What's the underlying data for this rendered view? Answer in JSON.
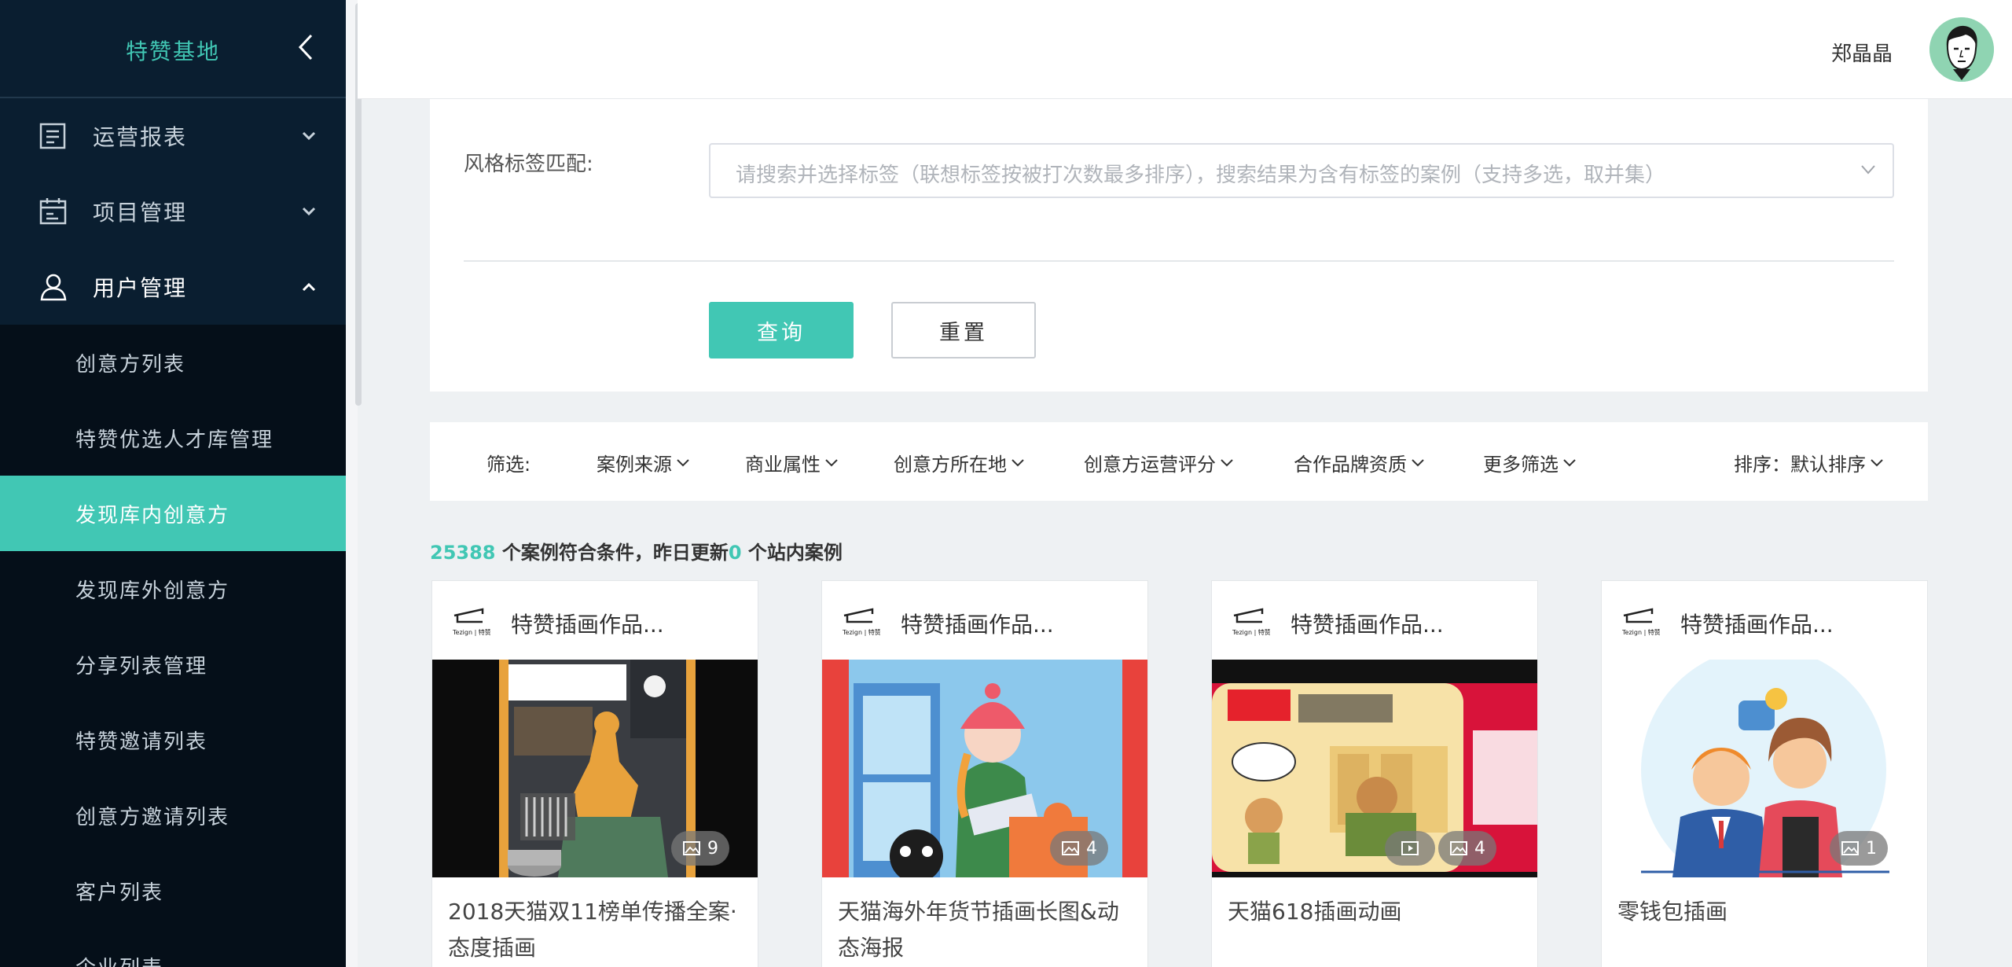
{
  "sidebar": {
    "brand": "特赞基地",
    "menus": [
      {
        "label": "运营报表",
        "icon": "report-icon"
      },
      {
        "label": "项目管理",
        "icon": "calendar-icon"
      },
      {
        "label": "用户管理",
        "icon": "user-icon"
      }
    ],
    "sub_items": [
      {
        "label": "创意方列表"
      },
      {
        "label": "特赞优选人才库管理"
      },
      {
        "label": "发现库内创意方"
      },
      {
        "label": "发现库外创意方"
      },
      {
        "label": "分享列表管理"
      },
      {
        "label": "特赞邀请列表"
      },
      {
        "label": "创意方邀请列表"
      },
      {
        "label": "客户列表"
      },
      {
        "label": "企业列表"
      }
    ],
    "active_item": "发现库内创意方"
  },
  "header": {
    "user_name": "郑晶晶"
  },
  "search": {
    "tag_label": "风格标签匹配:",
    "tag_placeholder": "请搜索并选择标签（联想标签按被打次数最多排序），搜索结果为含有标签的案例（支持多选，取并集）",
    "query_button": "查询",
    "reset_button": "重置"
  },
  "filters": {
    "label": "筛选:",
    "items": [
      "案例来源",
      "商业属性",
      "创意方所在地",
      "创意方运营评分",
      "合作品牌资质",
      "更多筛选"
    ],
    "sort": "排序：默认排序"
  },
  "stats": {
    "count": "25388",
    "text1": " 个案例符合条件，昨日更新",
    "updated": "0",
    "text2": " 个站内案例"
  },
  "cards": [
    {
      "brand": "特赞插画作品...",
      "title": "2018天猫双11榜单传播全案·态度插画",
      "image_count": "9"
    },
    {
      "brand": "特赞插画作品...",
      "title": "天猫海外年货节插画长图&动态海报",
      "image_count": "4"
    },
    {
      "brand": "特赞插画作品...",
      "title": "天猫618插画动画",
      "image_count": "4"
    },
    {
      "brand": "特赞插画作品...",
      "title": "零钱包插画",
      "image_count": "1"
    }
  ],
  "colors": {
    "accent": "#41c7b4",
    "sidebar_bg": "#0a1e30",
    "submenu_bg": "#050f19"
  }
}
